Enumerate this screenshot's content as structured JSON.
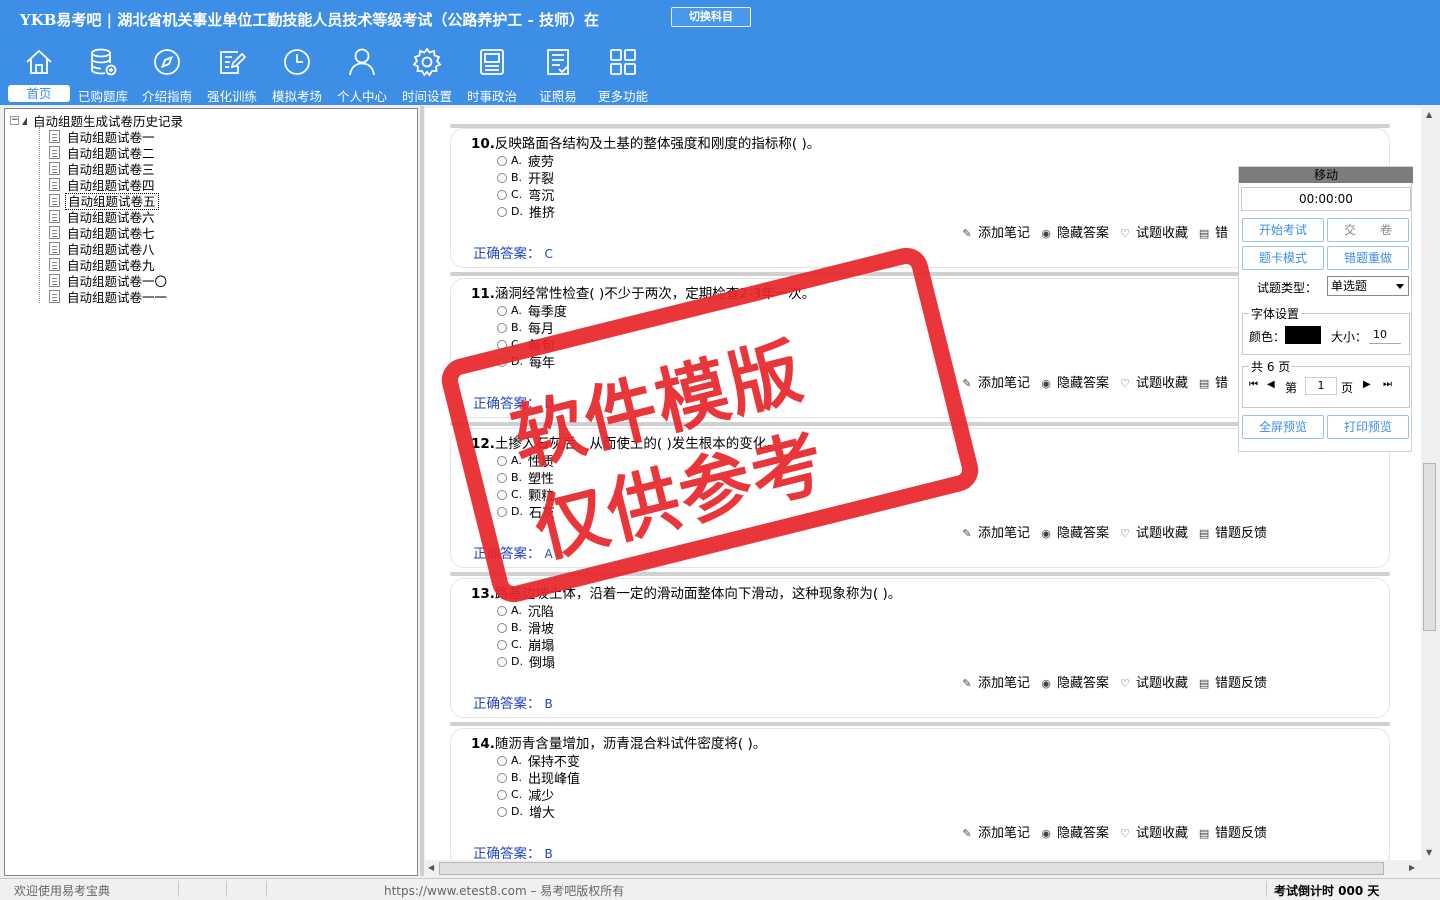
{
  "header": {
    "logo": "YKB易考吧",
    "title": "湖北省机关事业单位工勤技能人员技术等级考试（公路养护工 - 技师）在",
    "switch_subject": "切换科目"
  },
  "nav": [
    {
      "label": "首页",
      "icon": "home-icon"
    },
    {
      "label": "已购题库",
      "icon": "database-icon"
    },
    {
      "label": "介绍指南",
      "icon": "compass-icon"
    },
    {
      "label": "强化训练",
      "icon": "edit-icon"
    },
    {
      "label": "模拟考场",
      "icon": "clock-icon"
    },
    {
      "label": "个人中心",
      "icon": "user-icon"
    },
    {
      "label": "时间设置",
      "icon": "gear-icon"
    },
    {
      "label": "时事政治",
      "icon": "news-icon"
    },
    {
      "label": "证照易",
      "icon": "certificate-icon"
    },
    {
      "label": "更多功能",
      "icon": "grid-icon"
    }
  ],
  "tree": {
    "root": "自动组题生成试卷历史记录",
    "items": [
      "自动组题试卷一",
      "自动组题试卷二",
      "自动组题试卷三",
      "自动组题试卷四",
      "自动组题试卷五",
      "自动组题试卷六",
      "自动组题试卷七",
      "自动组题试卷八",
      "自动组题试卷九",
      "自动组题试卷一〇",
      "自动组题试卷一一"
    ],
    "selected_index": 4
  },
  "actions": {
    "note": "添加笔记",
    "hide": "隐藏答案",
    "fav": "试题收藏",
    "feedback": "错题反馈",
    "feedback_partial": "错"
  },
  "answer_label": "正确答案：",
  "questions": [
    {
      "num": "10.",
      "text": "反映路面各结构及土基的整体强度和刚度的指标称( )。",
      "options": [
        [
          "A.",
          "疲劳"
        ],
        [
          "B.",
          "开裂"
        ],
        [
          "C.",
          "弯沉"
        ],
        [
          "D.",
          "推挤"
        ]
      ],
      "answer": "C"
    },
    {
      "num": "11.",
      "text": "涵洞经常性检查( )不少于两次，定期检查2-3年一次。",
      "options": [
        [
          "A.",
          "每季度"
        ],
        [
          "B.",
          "每月"
        ],
        [
          "C.",
          "每旬"
        ],
        [
          "D.",
          "每年"
        ]
      ],
      "answer": "D"
    },
    {
      "num": "12.",
      "text": "土掺入石灰后，从而使土的( )发生根本的变化。",
      "options": [
        [
          "A.",
          "性质"
        ],
        [
          "B.",
          "塑性"
        ],
        [
          "C.",
          "颗粒"
        ],
        [
          "D.",
          "石灰"
        ]
      ],
      "answer": "A"
    },
    {
      "num": "13.",
      "text": "路基边坡土体，沿着一定的滑动面整体向下滑动，这种现象称为( )。",
      "options": [
        [
          "A.",
          "沉陷"
        ],
        [
          "B.",
          "滑坡"
        ],
        [
          "C.",
          "崩塌"
        ],
        [
          "D.",
          "倒塌"
        ]
      ],
      "answer": "B"
    },
    {
      "num": "14.",
      "text": "随沥青含量增加，沥青混合料试件密度将( )。",
      "options": [
        [
          "A.",
          "保持不变"
        ],
        [
          "B.",
          "出现峰值"
        ],
        [
          "C.",
          "减少"
        ],
        [
          "D.",
          "增大"
        ]
      ],
      "answer": "B"
    }
  ],
  "panel": {
    "move": "移动",
    "timer": "00:00:00",
    "start_exam": "开始考试",
    "submit": "交　　卷",
    "card_mode": "题卡模式",
    "redo_wrong": "错题重做",
    "type_label": "试题类型：",
    "type_value": "单选题",
    "font_settings": "字体设置",
    "color_label": "颜色：",
    "size_label": "大小：",
    "size_value": "10",
    "total_pages": "共 6 页",
    "page_prefix": "第",
    "page_value": "1",
    "page_suffix": "页",
    "fullscreen": "全屏预览",
    "print": "打印预览"
  },
  "colors": {
    "brand": "#3d8ee6",
    "stamp": "#e8272c",
    "answer": "#2244bb"
  },
  "stamp": {
    "line1": "软件模版",
    "line2": "仅供参考"
  },
  "status": {
    "welcome": "欢迎使用易考宝典",
    "copyright": "https://www.etest8.com – 易考吧版权所有",
    "countdown": "考试倒计时 000 天"
  }
}
